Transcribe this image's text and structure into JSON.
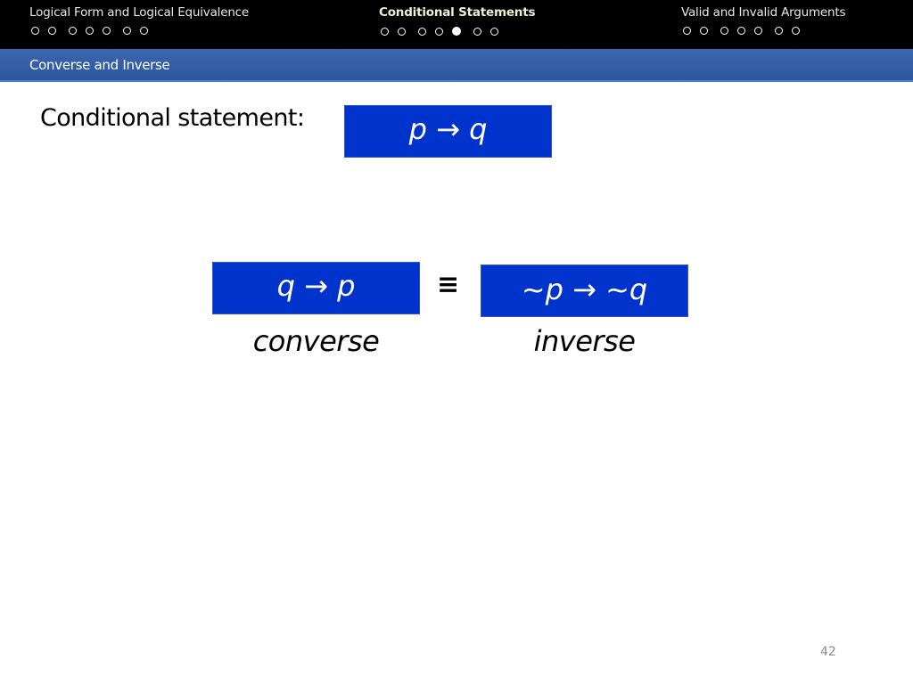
{
  "nav": {
    "sections": [
      {
        "title": "Logical Form and Logical Equivalence",
        "active": false,
        "slides": 7,
        "current": -1
      },
      {
        "title": "Conditional Statements",
        "active": true,
        "slides": 7,
        "current": 4
      },
      {
        "title": "Valid and Invalid Arguments",
        "active": false,
        "slides": 7,
        "current": -1
      }
    ]
  },
  "subheader": {
    "title": "Converse and Inverse"
  },
  "content": {
    "conditional_label": "Conditional statement:",
    "conditional_formula": "p → q",
    "converse_formula": "q → p",
    "equivalence_symbol": "≡",
    "inverse_formula": "~p → ~q",
    "converse_caption": "converse",
    "inverse_caption": "inverse"
  },
  "colors": {
    "formula_box": "#0033cc",
    "subheader_bar": "#3560a8",
    "topbar": "#000000"
  },
  "footer": {
    "page_number": "42"
  }
}
